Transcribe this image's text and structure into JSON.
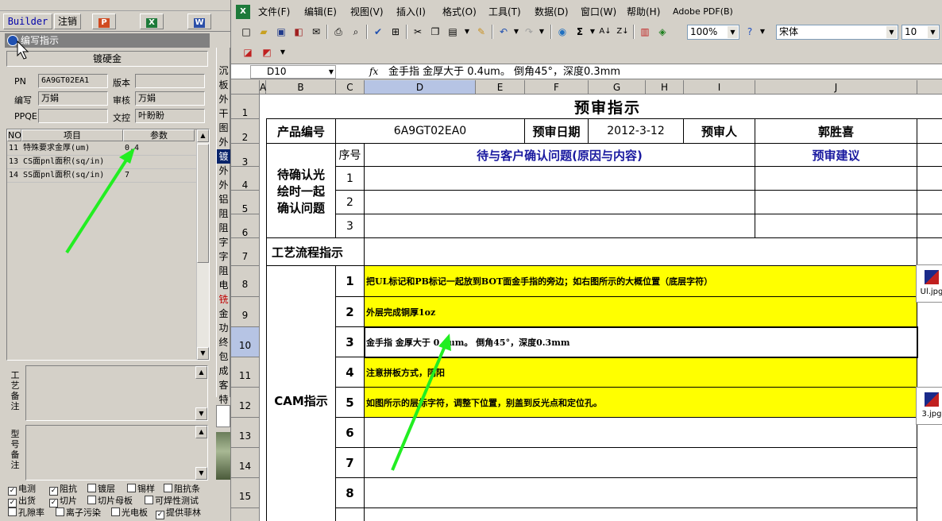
{
  "left_panel": {
    "toolbar": {
      "builder_label": "Builder",
      "logout_label": "注销"
    },
    "window_title": "编写指示",
    "plate_type": "镀硬金",
    "form": {
      "pn_label": "PN",
      "pn_value": "6A9GT02EA1",
      "version_label": "版本",
      "version_value": "",
      "writer_label": "编写",
      "writer_value": "万娟",
      "reviewer_label": "审核",
      "reviewer_value": "万娟",
      "ppqe_label": "PPQE",
      "ppqe_value": "",
      "doc_control_label": "文控",
      "doc_control_value": "叶盼盼"
    },
    "params": {
      "headers": [
        "NO",
        "项目",
        "参数"
      ],
      "rows": [
        {
          "no_item": "11 特殊要求金厚(um)",
          "value": "0.4"
        },
        {
          "no_item": "13 CS面pnl面积(sq/in)",
          "value": ""
        },
        {
          "no_item": "14 SS面pnl面积(sq/in)",
          "value": "7"
        }
      ]
    },
    "remarks": {
      "process_label": "工艺备注",
      "model_label": "型号备注"
    },
    "vertical_tabs": [
      "沉",
      "板",
      "外",
      "干",
      "图",
      "外",
      "镀",
      "外",
      "外",
      "铝",
      "阻",
      "阻",
      "字",
      "字",
      "阻",
      "电",
      "铣",
      "金",
      "功",
      "终",
      "包",
      "成",
      "客",
      "特"
    ],
    "checkboxes": [
      {
        "label": "电测",
        "checked": true
      },
      {
        "label": "阻抗",
        "checked": true
      },
      {
        "label": "镀层",
        "checked": false
      },
      {
        "label": "锡样",
        "checked": false
      },
      {
        "label": "阻抗条",
        "checked": false
      },
      {
        "label": "出货",
        "checked": true
      },
      {
        "label": "切片",
        "checked": true
      },
      {
        "label": "切片母板",
        "checked": false
      },
      {
        "label": "可焊性测试",
        "checked": false
      },
      {
        "label": "孔隙率",
        "checked": false
      },
      {
        "label": "离子污染",
        "checked": false
      },
      {
        "label": "光电板",
        "checked": false
      },
      {
        "label": "提供菲林",
        "checked": true
      }
    ]
  },
  "excel": {
    "menu": [
      "文件(F)",
      "编辑(E)",
      "视图(V)",
      "插入(I)",
      "格式(O)",
      "工具(T)",
      "数据(D)",
      "窗口(W)",
      "帮助(H)",
      "Adobe PDF(B)"
    ],
    "zoom": "100%",
    "font_name": "宋体",
    "font_size": "10",
    "name_box": "D10",
    "fx": "fx",
    "formula": "金手指 金厚大于 0.4um。 倒角45°，深度0.3mm",
    "columns": [
      "A",
      "B",
      "C",
      "D",
      "E",
      "F",
      "G",
      "H",
      "I",
      "J"
    ],
    "rows": [
      "1",
      "2",
      "3",
      "4",
      "5",
      "6",
      "7",
      "8",
      "9",
      "10",
      "11",
      "12",
      "13",
      "14",
      "15"
    ],
    "sheet": {
      "title": "预审指示",
      "product_no_label": "产品编号",
      "product_no": "6A9GT02EA0",
      "review_date_label": "预审日期",
      "review_date": "2012-3-12",
      "reviewer_label": "预审人",
      "reviewer": "郭胜喜",
      "pending_label": "待确认光绘时一起确认问题",
      "seq_label": "序号",
      "issue_header": "待与客户确认问题(原因与内容)",
      "suggestion_header": "预审建议",
      "pending_nums": [
        "1",
        "2",
        "3"
      ],
      "process_label": "工艺流程指示",
      "cam_label": "CAM指示",
      "cam_items": [
        {
          "no": "1",
          "text": "把UL标记和PB标记一起放到BOT面金手指的旁边；如右图所示的大概位置（底层字符）",
          "yellow": true
        },
        {
          "no": "2",
          "text": "外层完成铜厚1oz",
          "yellow": true
        },
        {
          "no": "3",
          "text": "金手指 金厚大于 0.4um。 倒角45°，深度0.3mm",
          "yellow": false
        },
        {
          "no": "4",
          "text": "注意拼板方式，阴阳",
          "yellow": true
        },
        {
          "no": "5",
          "text": "如图所示的层标字符，调整下位置，别盖到反光点和定位孔。",
          "yellow": true
        },
        {
          "no": "6",
          "text": "",
          "yellow": false
        },
        {
          "no": "7",
          "text": "",
          "yellow": false
        },
        {
          "no": "8",
          "text": "",
          "yellow": false
        }
      ],
      "attachments": [
        "Ul.jpg",
        "3.jpg"
      ]
    }
  },
  "colors": {
    "highlight_yellow": "#ffff00",
    "arrow_green": "#22ee22",
    "header_blue": "#1a1aa0"
  }
}
